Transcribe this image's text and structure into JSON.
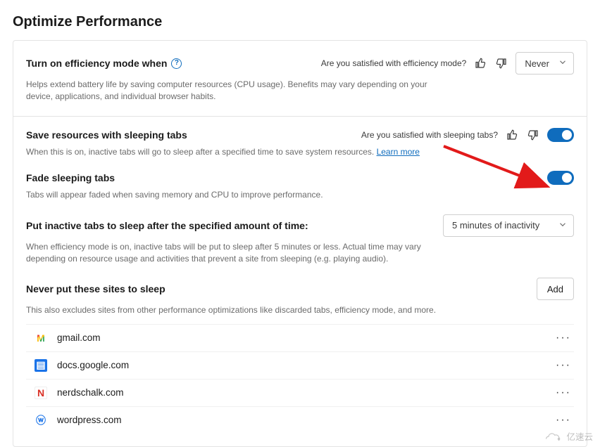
{
  "page_title": "Optimize Performance",
  "efficiency": {
    "heading": "Turn on efficiency mode when",
    "desc": "Helps extend battery life by saving computer resources (CPU usage). Benefits may vary depending on your device, applications, and individual browser habits.",
    "question": "Are you satisfied with efficiency mode?",
    "select_value": "Never"
  },
  "sleeping": {
    "heading": "Save resources with sleeping tabs",
    "desc1": "When this is on, inactive tabs will go to sleep after a specified time to save system resources. ",
    "learn_more": "Learn more",
    "question": "Are you satisfied with sleeping tabs?",
    "toggle_main": true,
    "fade": {
      "heading": "Fade sleeping tabs",
      "desc": "Tabs will appear faded when saving memory and CPU to improve performance.",
      "toggle": true
    },
    "timeout": {
      "heading": "Put inactive tabs to sleep after the specified amount of time:",
      "desc": "When efficiency mode is on, inactive tabs will be put to sleep after 5 minutes or less. Actual time may vary depending on resource usage and activities that prevent a site from sleeping (e.g. playing audio).",
      "select_value": "5 minutes of inactivity"
    },
    "never": {
      "heading": "Never put these sites to sleep",
      "desc": "This also excludes sites from other performance optimizations like discarded tabs, efficiency mode, and more.",
      "add_label": "Add",
      "sites": [
        {
          "name": "gmail.com",
          "icon": "gmail-icon",
          "glyph": "M"
        },
        {
          "name": "docs.google.com",
          "icon": "docs-icon",
          "glyph": "▤"
        },
        {
          "name": "nerdschalk.com",
          "icon": "nerds-icon",
          "glyph": "N"
        },
        {
          "name": "wordpress.com",
          "icon": "wp-icon",
          "glyph": "ⓦ"
        }
      ]
    }
  },
  "watermark": "亿速云"
}
